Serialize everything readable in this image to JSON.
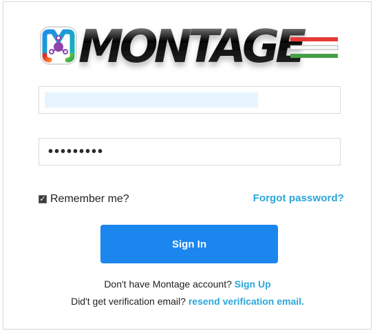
{
  "logo": {
    "text": "MONTAGE",
    "icon": "montage-logo-icon"
  },
  "form": {
    "username": {
      "value": "",
      "placeholder": ""
    },
    "password": {
      "masked_value": "•••••••••",
      "placeholder": ""
    },
    "remember": {
      "label": "Remember me?",
      "checked": true
    },
    "forgot_password": "Forgot password?",
    "signin_button": "Sign In"
  },
  "footer": {
    "signup_prefix": "Don't have Montage account? ",
    "signup_link": "Sign Up",
    "verification_prefix": "Did't get verification email? ",
    "verification_link": "resend verification email."
  },
  "colors": {
    "primary": "#1b86ee",
    "link": "#2aa6da",
    "autofill": "#e6f5ff"
  }
}
